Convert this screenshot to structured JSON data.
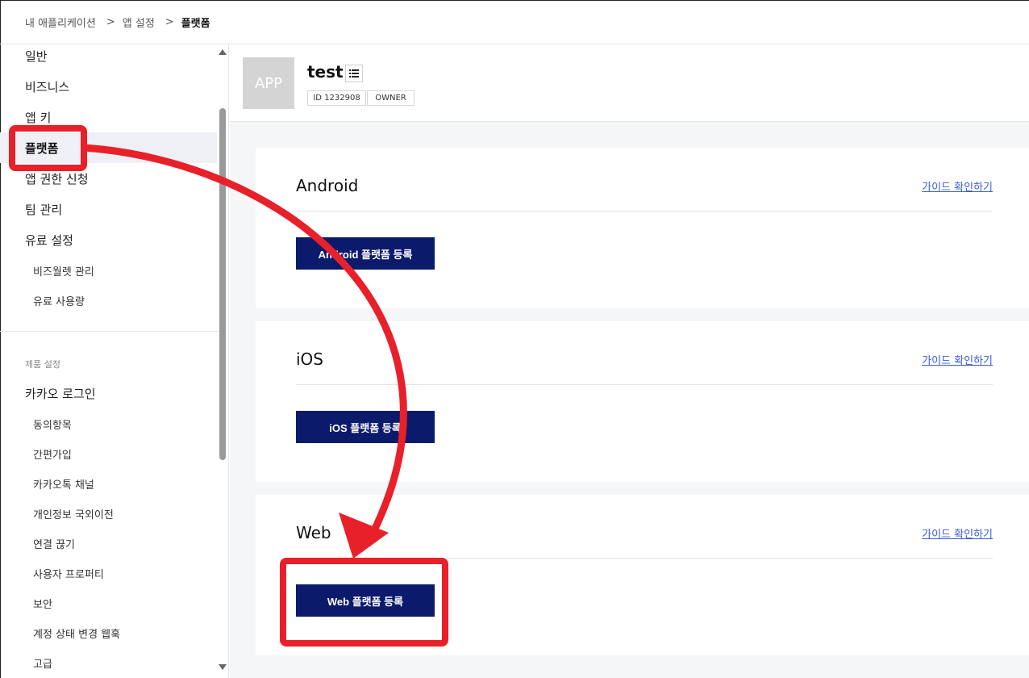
{
  "breadcrumb": {
    "items": [
      "내 애플리케이션",
      "앱 설정",
      "플랫폼"
    ],
    "separator": ">"
  },
  "sidebar": {
    "items": [
      {
        "label": "일반"
      },
      {
        "label": "비즈니스"
      },
      {
        "label": "앱 키"
      },
      {
        "label": "플랫폼"
      },
      {
        "label": "앱 권한 신청"
      },
      {
        "label": "팀 관리"
      },
      {
        "label": "유료 설정"
      }
    ],
    "sub_items": [
      {
        "label": "비즈월렛 관리"
      },
      {
        "label": "유료 사용량"
      }
    ],
    "section_title": "제품 설정",
    "product_items": [
      {
        "label": "카카오 로그인"
      }
    ],
    "product_sub_items": [
      {
        "label": "동의항목"
      },
      {
        "label": "간편가입"
      },
      {
        "label": "카카오톡 채널"
      },
      {
        "label": "개인정보 국외이전"
      },
      {
        "label": "연결 끊기"
      },
      {
        "label": "사용자 프로퍼티"
      },
      {
        "label": "보안"
      },
      {
        "label": "계정 상태 변경 웹훅"
      },
      {
        "label": "고급"
      }
    ],
    "active_item": "플랫폼"
  },
  "app": {
    "icon_text": "APP",
    "name": "test",
    "id_tag": "ID 1232908",
    "role_tag": "OWNER"
  },
  "platforms": [
    {
      "title": "Android",
      "guide_link": "가이드 확인하기",
      "button": "Android 플랫폼 등록"
    },
    {
      "title": "iOS",
      "guide_link": "가이드 확인하기",
      "button": "iOS 플랫폼 등록"
    },
    {
      "title": "Web",
      "guide_link": "가이드 확인하기",
      "button": "Web 플랫폼 등록"
    }
  ],
  "colors": {
    "primary_button": "#0c1a6b",
    "annotation_red": "#e8202a",
    "link": "#3b5bdb"
  }
}
